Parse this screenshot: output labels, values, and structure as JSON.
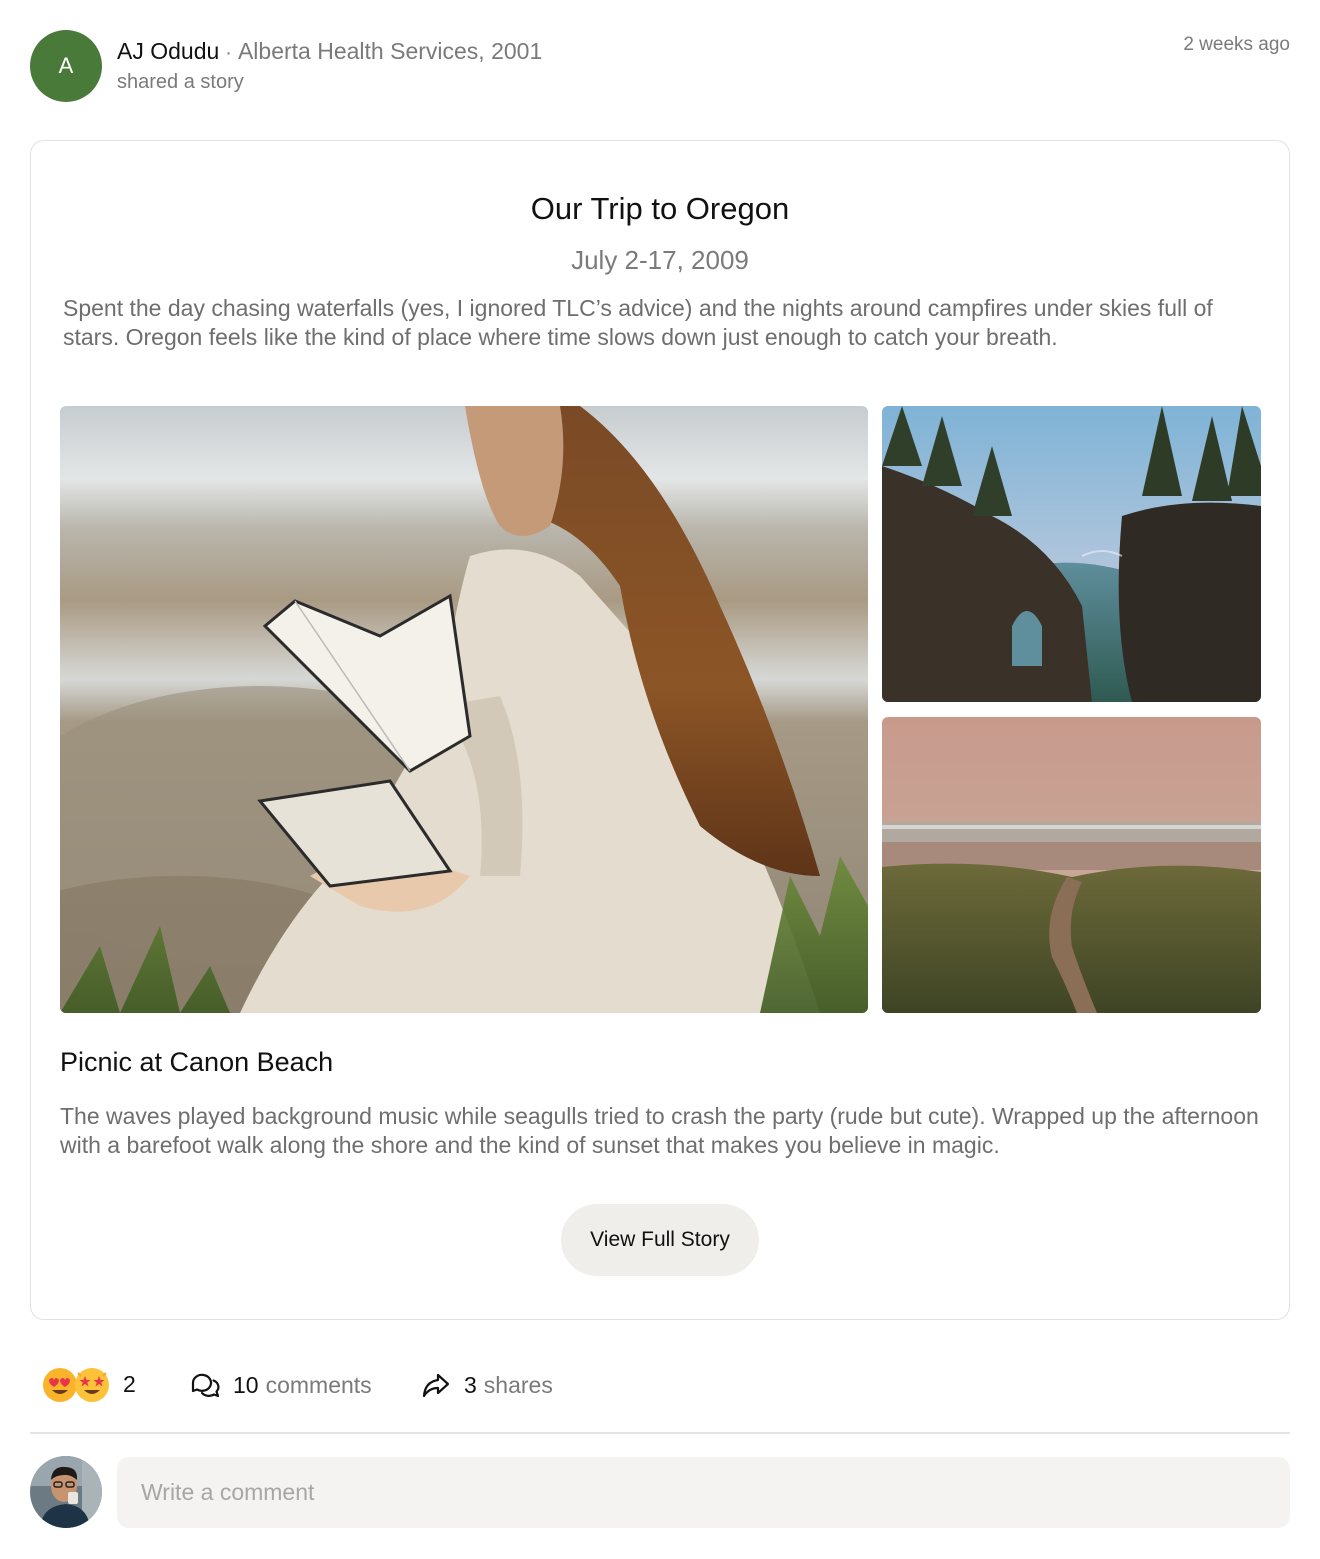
{
  "post": {
    "author": {
      "avatar_initial": "A",
      "avatar_color": "#4a7a3a",
      "name": "AJ Odudu",
      "separator": "·",
      "organization": "Alberta Health Services, 2001",
      "action": "shared a story"
    },
    "timestamp": "2 weeks ago"
  },
  "story": {
    "title": "Our Trip to Oregon",
    "date_range": "July 2-17, 2009",
    "intro": "Spent the day chasing waterfalls (yes, I ignored TLC’s advice) and the nights around campfires under skies full of stars. Oregon feels like the kind of place where time slows down just enough to catch your breath.",
    "photos": [
      "woman-reading-on-beach-photo",
      "sea-cliffs-arch-photo",
      "beach-dunes-trail-photo"
    ],
    "section": {
      "title": "Picnic at Canon Beach",
      "body": "The waves played background music while seagulls tried to crash the party (rude but cute). Wrapped up the afternoon with a barefoot walk along the shore and the kind of sunset that makes you believe in magic."
    },
    "view_button_label": "View Full Story"
  },
  "engagement": {
    "reactions": [
      "heart-eyes-emoji",
      "star-struck-emoji"
    ],
    "reaction_count": "2",
    "comments_count": "10",
    "comments_label": "comments",
    "comments_icon": "comment-bubbles-icon",
    "shares_count": "3",
    "shares_label": "shares",
    "shares_icon": "share-arrow-icon"
  },
  "composer": {
    "placeholder": "Write a comment",
    "value": ""
  }
}
